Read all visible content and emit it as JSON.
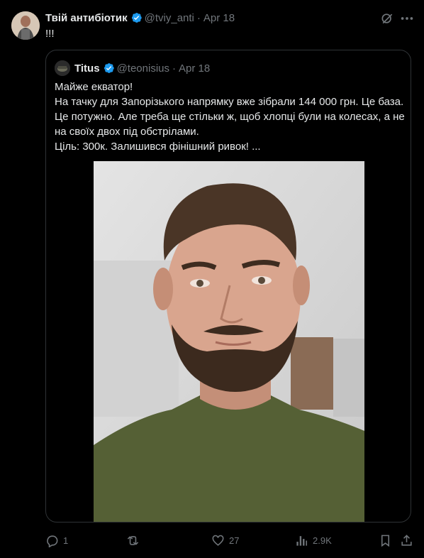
{
  "tweet": {
    "author_name": "Твій антибіотик",
    "handle": "@tviy_anti",
    "date": "Apr 18",
    "text": "!!!"
  },
  "quote": {
    "author_name": "Titus",
    "handle": "@teonisius",
    "date": "Apr 18",
    "lines": [
      "Майже екватор!",
      "На тачку для Запорізького напрямку вже зібрали 144 000 грн. Це база.",
      "Це потужно. Але треба ще стільки ж, щоб хлопці були на колесах, а не",
      "на своїх двох під обстрілами.",
      "Ціль: 300к. Залишився фінішний ривок! ..."
    ]
  },
  "actions": {
    "replies": "1",
    "reposts": "",
    "likes": "27",
    "views": "2.9K"
  },
  "colors": {
    "background": "#000000",
    "text": "#e7e9ea",
    "muted": "#71767b",
    "verified": "#1d9bf0",
    "border": "#2f3336"
  },
  "icons": [
    "verified-badge-icon",
    "grok-icon",
    "more-icon",
    "reply-icon",
    "repost-icon",
    "like-icon",
    "views-icon",
    "bookmark-icon",
    "share-icon"
  ]
}
